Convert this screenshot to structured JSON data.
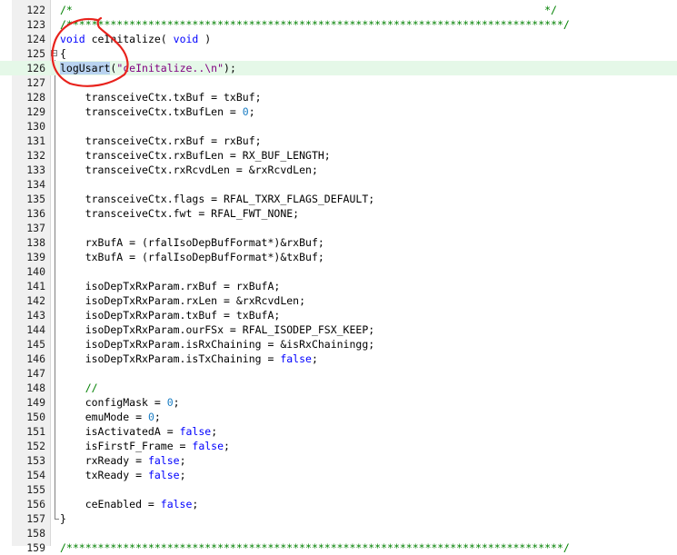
{
  "editor": {
    "current_line": "126",
    "lines": [
      {
        "n": "122",
        "tokens": [
          {
            "t": "/*",
            "c": "#008000"
          },
          {
            "t": "                                                                           */",
            "c": "#008000"
          }
        ]
      },
      {
        "n": "123",
        "tokens": [
          {
            "t": "/*******************************************************************************/",
            "c": "#008000"
          }
        ]
      },
      {
        "n": "124",
        "tokens": [
          {
            "t": "void",
            "c": "#0000ff"
          },
          {
            "t": " ceInitalize( ",
            "c": "#000000"
          },
          {
            "t": "void",
            "c": "#0000ff"
          },
          {
            "t": " )",
            "c": "#000000"
          }
        ]
      },
      {
        "n": "125",
        "tokens": [
          {
            "t": "{",
            "c": "#000000"
          }
        ]
      },
      {
        "n": "126",
        "tokens": [
          {
            "t": "logUsart",
            "c": "#000000",
            "sel": true
          },
          {
            "t": "(",
            "c": "#000000"
          },
          {
            "t": "\"ceInitalize..\\n\"",
            "c": "#800080"
          },
          {
            "t": ");",
            "c": "#000000"
          }
        ]
      },
      {
        "n": "127",
        "tokens": []
      },
      {
        "n": "128",
        "tokens": [
          {
            "t": "    transceiveCtx.txBuf = txBuf;",
            "c": "#000000"
          }
        ]
      },
      {
        "n": "129",
        "tokens": [
          {
            "t": "    transceiveCtx.txBufLen = ",
            "c": "#000000"
          },
          {
            "t": "0",
            "c": "#1a7dc4"
          },
          {
            "t": ";",
            "c": "#000000"
          }
        ]
      },
      {
        "n": "130",
        "tokens": []
      },
      {
        "n": "131",
        "tokens": [
          {
            "t": "    transceiveCtx.rxBuf = rxBuf;",
            "c": "#000000"
          }
        ]
      },
      {
        "n": "132",
        "tokens": [
          {
            "t": "    transceiveCtx.rxBufLen = RX_BUF_LENGTH;",
            "c": "#000000"
          }
        ]
      },
      {
        "n": "133",
        "tokens": [
          {
            "t": "    transceiveCtx.rxRcvdLen = &rxRcvdLen;",
            "c": "#000000"
          }
        ]
      },
      {
        "n": "134",
        "tokens": []
      },
      {
        "n": "135",
        "tokens": [
          {
            "t": "    transceiveCtx.flags = RFAL_TXRX_FLAGS_DEFAULT;",
            "c": "#000000"
          }
        ]
      },
      {
        "n": "136",
        "tokens": [
          {
            "t": "    transceiveCtx.fwt = RFAL_FWT_NONE;",
            "c": "#000000"
          }
        ]
      },
      {
        "n": "137",
        "tokens": []
      },
      {
        "n": "138",
        "tokens": [
          {
            "t": "    rxBufA = (rfalIsoDepBufFormat*)&rxBuf;",
            "c": "#000000"
          }
        ]
      },
      {
        "n": "139",
        "tokens": [
          {
            "t": "    txBufA = (rfalIsoDepBufFormat*)&txBuf;",
            "c": "#000000"
          }
        ]
      },
      {
        "n": "140",
        "tokens": []
      },
      {
        "n": "141",
        "tokens": [
          {
            "t": "    isoDepTxRxParam.rxBuf = rxBufA;",
            "c": "#000000"
          }
        ]
      },
      {
        "n": "142",
        "tokens": [
          {
            "t": "    isoDepTxRxParam.rxLen = &rxRcvdLen;",
            "c": "#000000"
          }
        ]
      },
      {
        "n": "143",
        "tokens": [
          {
            "t": "    isoDepTxRxParam.txBuf = txBufA;",
            "c": "#000000"
          }
        ]
      },
      {
        "n": "144",
        "tokens": [
          {
            "t": "    isoDepTxRxParam.ourFSx = RFAL_ISODEP_FSX_KEEP;",
            "c": "#000000"
          }
        ]
      },
      {
        "n": "145",
        "tokens": [
          {
            "t": "    isoDepTxRxParam.isRxChaining = &isRxChainingg;",
            "c": "#000000"
          }
        ]
      },
      {
        "n": "146",
        "tokens": [
          {
            "t": "    isoDepTxRxParam.isTxChaining = ",
            "c": "#000000"
          },
          {
            "t": "false",
            "c": "#0000ff"
          },
          {
            "t": ";",
            "c": "#000000"
          }
        ]
      },
      {
        "n": "147",
        "tokens": []
      },
      {
        "n": "148",
        "tokens": [
          {
            "t": "    //",
            "c": "#008000"
          }
        ]
      },
      {
        "n": "149",
        "tokens": [
          {
            "t": "    configMask = ",
            "c": "#000000"
          },
          {
            "t": "0",
            "c": "#1a7dc4"
          },
          {
            "t": ";",
            "c": "#000000"
          }
        ]
      },
      {
        "n": "150",
        "tokens": [
          {
            "t": "    emuMode = ",
            "c": "#000000"
          },
          {
            "t": "0",
            "c": "#1a7dc4"
          },
          {
            "t": ";",
            "c": "#000000"
          }
        ]
      },
      {
        "n": "151",
        "tokens": [
          {
            "t": "    isActivatedA = ",
            "c": "#000000"
          },
          {
            "t": "false",
            "c": "#0000ff"
          },
          {
            "t": ";",
            "c": "#000000"
          }
        ]
      },
      {
        "n": "152",
        "tokens": [
          {
            "t": "    isFirstF_Frame = ",
            "c": "#000000"
          },
          {
            "t": "false",
            "c": "#0000ff"
          },
          {
            "t": ";",
            "c": "#000000"
          }
        ]
      },
      {
        "n": "153",
        "tokens": [
          {
            "t": "    rxReady = ",
            "c": "#000000"
          },
          {
            "t": "false",
            "c": "#0000ff"
          },
          {
            "t": ";",
            "c": "#000000"
          }
        ]
      },
      {
        "n": "154",
        "tokens": [
          {
            "t": "    txReady = ",
            "c": "#000000"
          },
          {
            "t": "false",
            "c": "#0000ff"
          },
          {
            "t": ";",
            "c": "#000000"
          }
        ]
      },
      {
        "n": "155",
        "tokens": []
      },
      {
        "n": "156",
        "tokens": [
          {
            "t": "    ceEnabled = ",
            "c": "#000000"
          },
          {
            "t": "false",
            "c": "#0000ff"
          },
          {
            "t": ";",
            "c": "#000000"
          }
        ]
      },
      {
        "n": "157",
        "tokens": [
          {
            "t": "}",
            "c": "#000000"
          }
        ]
      },
      {
        "n": "158",
        "tokens": []
      },
      {
        "n": "159",
        "tokens": [
          {
            "t": "/*******************************************************************************/",
            "c": "#008000"
          }
        ]
      }
    ],
    "colors": {
      "keyword": "#0000ff",
      "comment": "#008000",
      "string": "#800080",
      "number": "#1a7dc4",
      "current_line_bg": "#e5f8e8",
      "selection_bg": "#b9d3f0",
      "breakpoint": "#d81a1a",
      "annotation": "#e8221c"
    },
    "icons": {
      "breakpoint": "breakpoint-icon",
      "fold": "fold-toggle-icon"
    }
  }
}
